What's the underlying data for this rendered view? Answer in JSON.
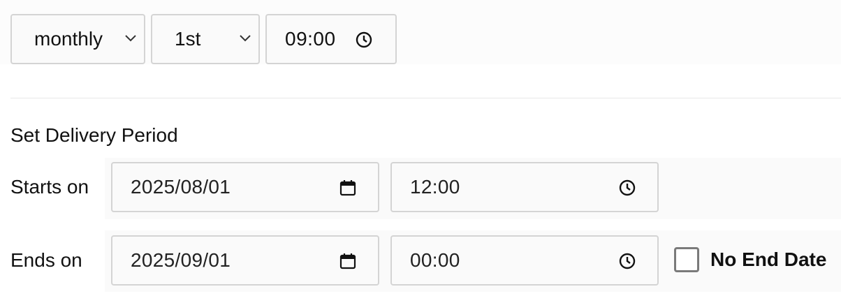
{
  "schedule": {
    "frequency": {
      "selected": "monthly"
    },
    "day": {
      "selected": "1st"
    },
    "time": {
      "value": "09:00"
    }
  },
  "delivery_period": {
    "title": "Set Delivery Period",
    "starts": {
      "label": "Starts on",
      "date": "2025/08/01",
      "time": "12:00"
    },
    "ends": {
      "label": "Ends on",
      "date": "2025/09/01",
      "time": "00:00"
    },
    "no_end_date": {
      "label": "No End Date",
      "checked": false
    }
  },
  "icons": {
    "dropdown": "chevron-down-icon",
    "clock": "clock-icon",
    "calendar": "calendar-icon"
  }
}
